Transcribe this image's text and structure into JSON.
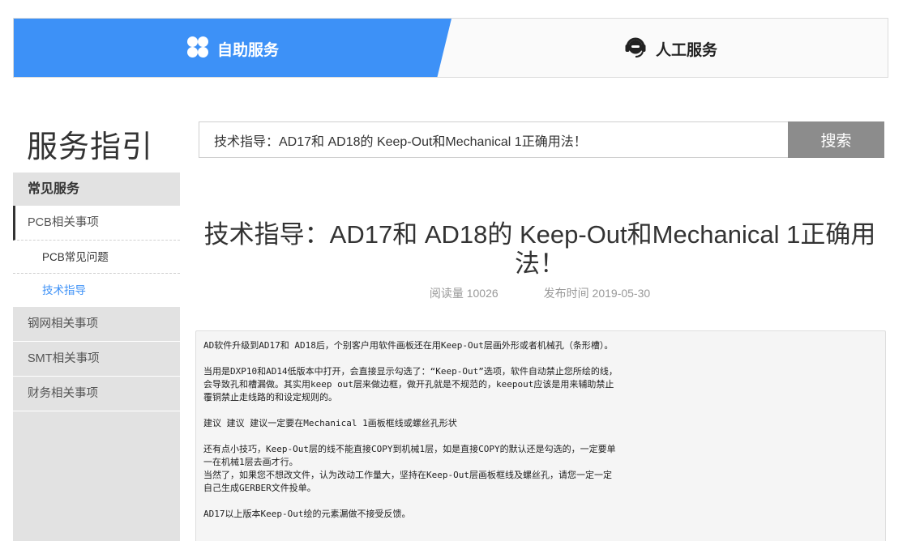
{
  "tabs": {
    "self_service": "自助服务",
    "manual_service": "人工服务"
  },
  "colors": {
    "accent": "#3d91f7",
    "search_button": "#8c8c8c",
    "sidebar_bg": "#e2e2e2"
  },
  "icons": {
    "self_service": "four-petal-icon",
    "manual_service": "headset-icon"
  },
  "page_title": "服务指引",
  "search": {
    "value": "技术指导：AD17和 AD18的 Keep-Out和Mechanical 1正确用法！",
    "button": "搜索"
  },
  "sidebar": {
    "header": "常见服务",
    "items": [
      {
        "label": "PCB相关事项"
      },
      {
        "label": "PCB常见问题"
      },
      {
        "label": "技术指导"
      },
      {
        "label": "钢网相关事项"
      },
      {
        "label": "SMT相关事项"
      },
      {
        "label": "财务相关事项"
      }
    ]
  },
  "article": {
    "title": "技术指导：AD17和 AD18的 Keep-Out和Mechanical 1正确用法！",
    "views": "阅读量 10026",
    "date": "发布时间 2019-05-30",
    "lines": [
      "AD软件升级到AD17和 AD18后，个别客户用软件画板还在用Keep-Out层画外形或者机械孔（条形槽）。",
      "当用是DXP10和AD14低版本中打开，会直接显示勾选了：“Keep-Out”选项，软件自动禁止您所绘的线，",
      "会导致孔和槽漏做。其实用keep out层来做边框，做开孔就是不规范的，keepout应该是用来辅助禁止",
      "覆铜禁止走线路的和设定规则的。",
      "建议  建议 建议一定要在Mechanical 1画板框线或螺丝孔形状",
      "还有点小技巧，Keep-Out层的线不能直接COPY到机械1层，如是直接COPY的默认还是勾选的，一定要单",
      "一在机械1层去画才行。",
      "当然了，如果您不想改文件，认为改动工作量大，坚持在Keep-Out层画板框线及螺丝孔，请您一定一定",
      "自己生成GERBER文件投单。",
      "AD17以上版本Keep-Out绘的元素漏做不接受反馈。"
    ]
  }
}
